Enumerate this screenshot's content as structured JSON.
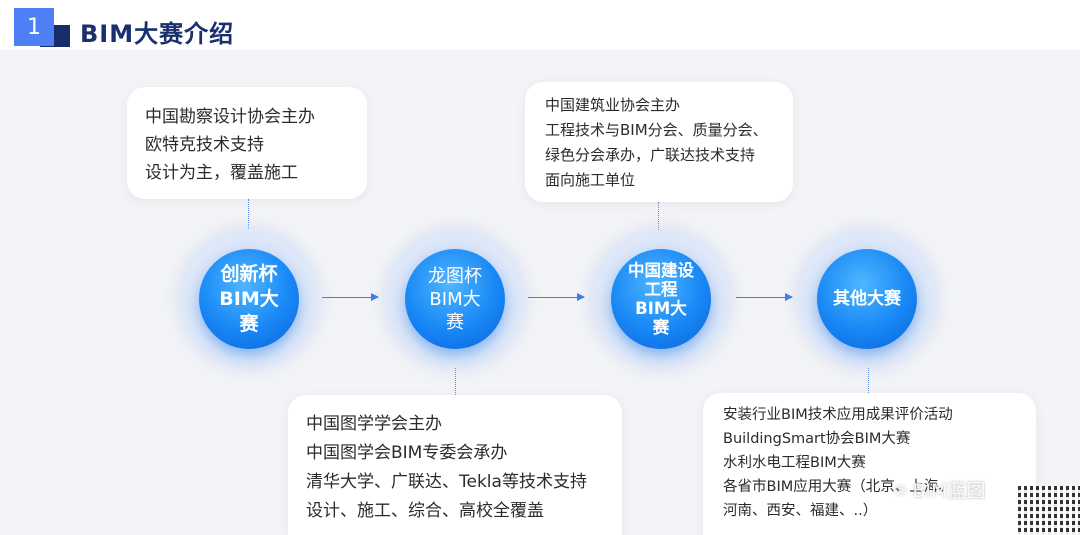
{
  "header": {
    "number": "1",
    "title": "BIM大赛介绍"
  },
  "competitions": [
    {
      "label": "创新杯\nBIM大\n赛",
      "info": [
        "中国勘察设计协会主办",
        "欧特克技术支持",
        "设计为主，覆盖施工"
      ]
    },
    {
      "label": "龙图杯\nBIM大\n赛",
      "info": [
        "中国图学学会主办",
        "中国图学会BIM专委会承办",
        "清华大学、广联达、Tekla等技术支持",
        "设计、施工、综合、高校全覆盖"
      ]
    },
    {
      "label": "中国建设\n工程\nBIM大\n赛",
      "info": [
        "中国建筑业协会主办",
        "工程技术与BIM分会、质量分会、",
        "绿色分会承办，广联达技术支持",
        "面向施工单位"
      ]
    },
    {
      "label": "其他大赛",
      "info": [
        "安装行业BIM技术应用成果评价活动",
        "BuildingSmart协会BIM大赛",
        "水利水电工程BIM大赛",
        "各省市BIM应用大赛（北京、上海、",
        "河南、西安、福建、..）"
      ]
    }
  ],
  "watermark": {
    "text": "BIM蓝图"
  },
  "colors": {
    "title": "#1a2f6e",
    "accent": "#4f7ff5",
    "ball": "#1887f5",
    "background": "#f3f4f7"
  }
}
